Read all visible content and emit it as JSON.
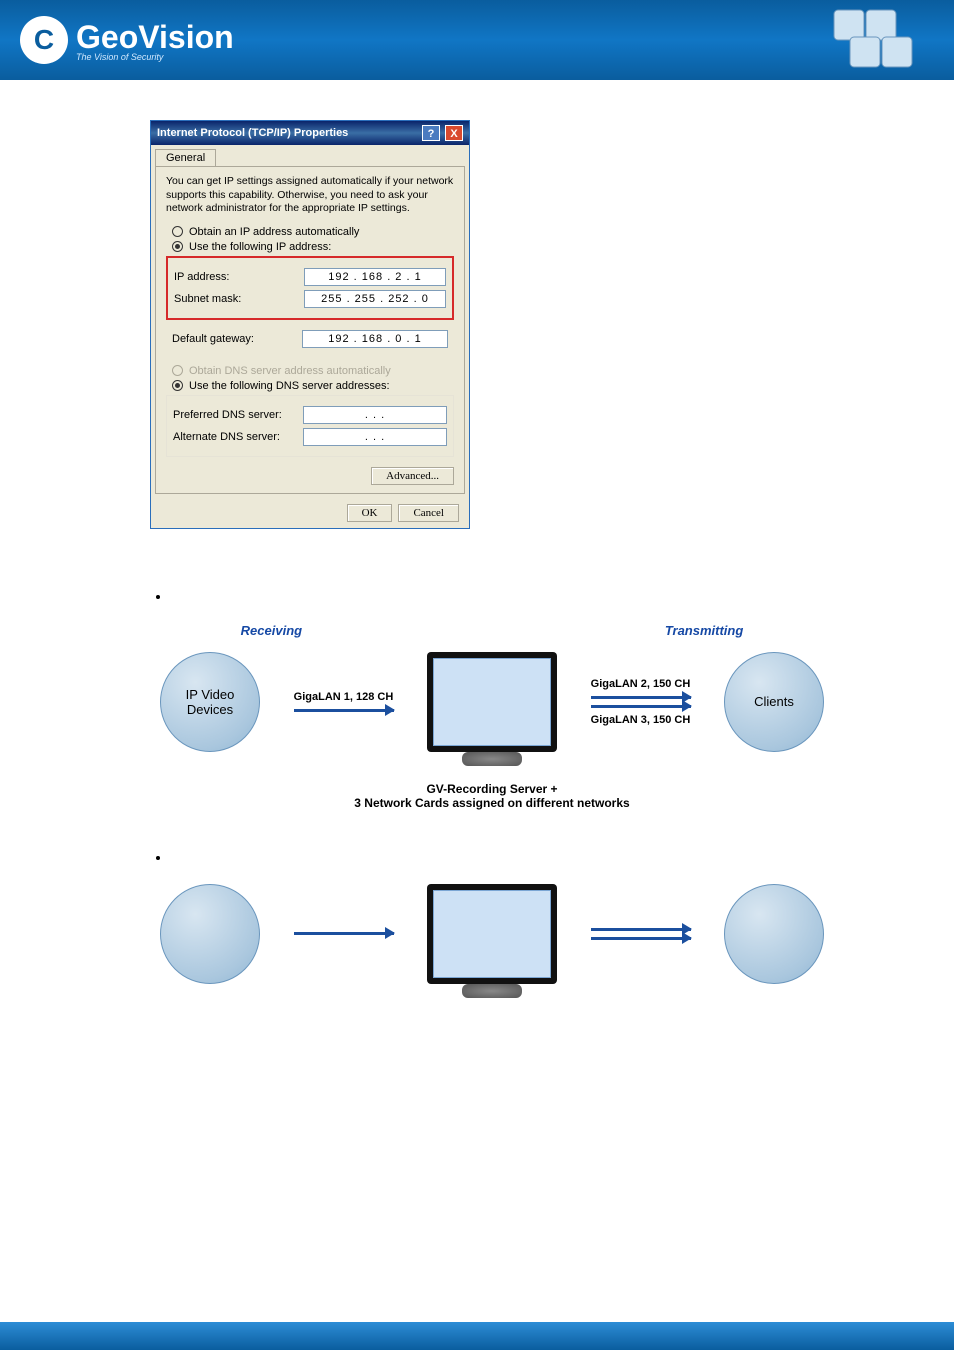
{
  "header": {
    "brand": "GeoVision",
    "tagline": "The Vision of Security",
    "logo_letter": "C"
  },
  "dialog": {
    "title": "Internet Protocol (TCP/IP) Properties",
    "tab": "General",
    "description": "You can get IP settings assigned automatically if your network supports this capability. Otherwise, you need to ask your network administrator for the appropriate IP settings.",
    "radio_auto_ip": "Obtain an IP address automatically",
    "radio_use_ip": "Use the following IP address:",
    "ip_label": "IP address:",
    "ip_value": "192 . 168 .   2  .   1",
    "subnet_label": "Subnet mask:",
    "subnet_value": "255 . 255 . 252 .   0",
    "gateway_label": "Default gateway:",
    "gateway_value": "192 . 168 .   0  .   1",
    "radio_auto_dns": "Obtain DNS server address automatically",
    "radio_use_dns": "Use the following DNS server addresses:",
    "pref_dns_label": "Preferred DNS server:",
    "pref_dns_value": " .       .       . ",
    "alt_dns_label": "Alternate DNS server:",
    "alt_dns_value": " .       .       . ",
    "advanced_btn": "Advanced...",
    "ok_btn": "OK",
    "cancel_btn": "Cancel"
  },
  "diagram1": {
    "receiving_lbl": "Receiving",
    "transmitting_lbl": "Transmitting",
    "left_node": "IP Video Devices",
    "right_node": "Clients",
    "lan1": "GigaLAN 1, 128 CH",
    "lan2": "GigaLAN 2, 150 CH",
    "lan3": "GigaLAN 3, 150 CH",
    "caption_line1": "GV-Recording Server +",
    "caption_line2": "3 Network Cards assigned on different networks"
  }
}
